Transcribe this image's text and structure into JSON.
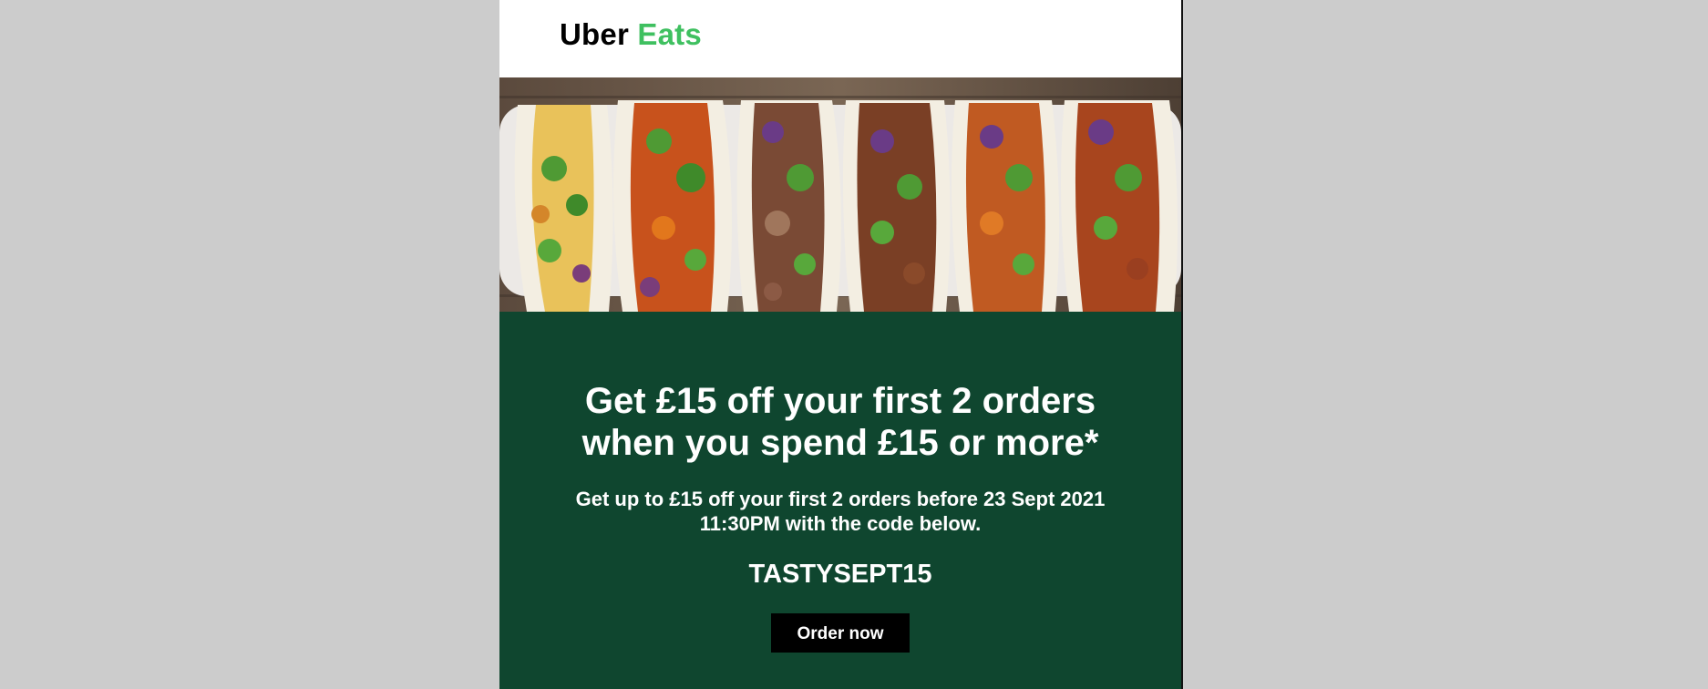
{
  "brand": {
    "name_part1": "Uber",
    "name_part2": "Eats",
    "accent_color": "#3fc060"
  },
  "hero": {
    "icon": "tacos-photo"
  },
  "promo": {
    "headline": "Get £15 off your first 2 orders when you spend £15 or more*",
    "subtext": "Get up to £15 off your first 2 orders before 23 Sept 2021 11:30PM with the code below.",
    "code": "TASTYSEPT15",
    "cta_label": "Order now",
    "background_color": "#0f462f"
  }
}
